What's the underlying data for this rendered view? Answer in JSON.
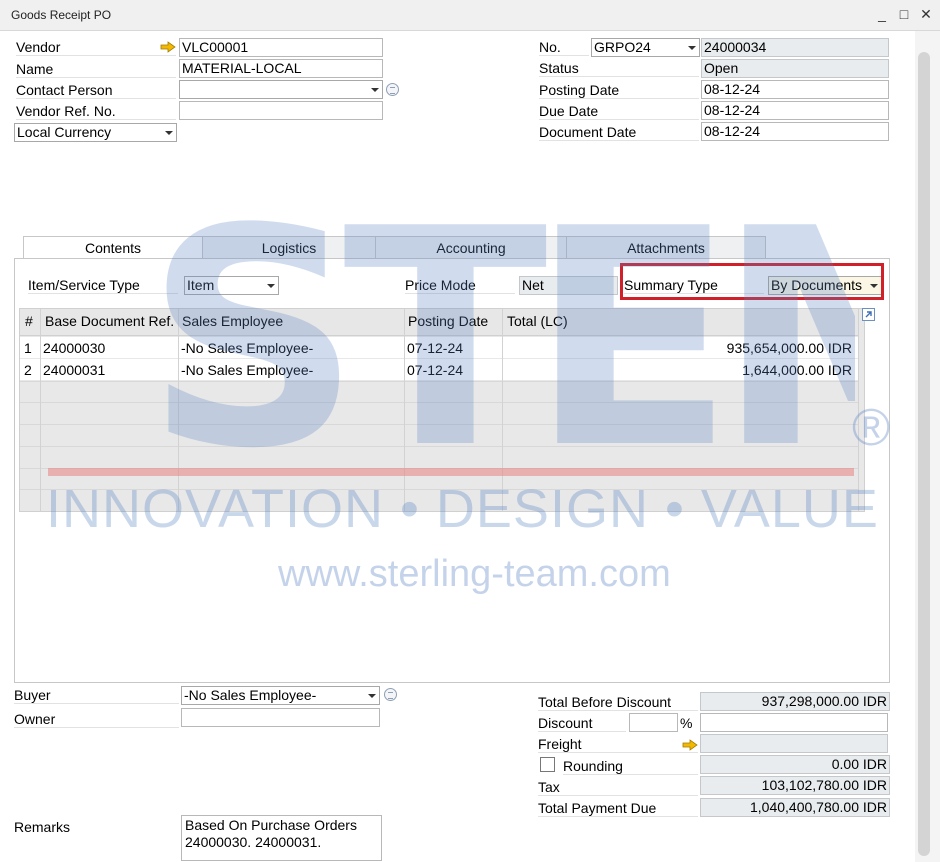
{
  "window": {
    "title": "Goods Receipt PO",
    "minimize": "_",
    "maximize": "□",
    "close": "✕"
  },
  "header_left": {
    "vendor_label": "Vendor",
    "vendor_value": "VLC00001",
    "name_label": "Name",
    "name_value": "MATERIAL-LOCAL",
    "contact_label": "Contact Person",
    "contact_value": "",
    "vendor_ref_label": "Vendor Ref. No.",
    "vendor_ref_value": "",
    "currency_value": "Local Currency"
  },
  "header_right": {
    "no_label": "No.",
    "series_value": "GRPO24",
    "no_value": "24000034",
    "status_label": "Status",
    "status_value": "Open",
    "posting_label": "Posting Date",
    "posting_value": "08-12-24",
    "due_label": "Due Date",
    "due_value": "08-12-24",
    "docdate_label": "Document Date",
    "docdate_value": "08-12-24"
  },
  "tabs": [
    {
      "label": "Contents"
    },
    {
      "label": "Logistics"
    },
    {
      "label": "Accounting"
    },
    {
      "label": "Attachments"
    }
  ],
  "contents": {
    "item_type_label": "Item/Service Type",
    "item_type_value": "Item",
    "price_mode_label": "Price Mode",
    "price_mode_value": "Net",
    "summary_type_label": "Summary Type",
    "summary_type_value": "By Documents"
  },
  "table": {
    "columns": [
      "#",
      "Base Document Ref.",
      "Sales Employee",
      "Posting Date",
      "Total (LC)"
    ],
    "rows": [
      {
        "num": "1",
        "base_ref": "24000030",
        "sales_emp": "-No Sales Employee-",
        "posting": "07-12-24",
        "total": "935,654,000.00 IDR"
      },
      {
        "num": "2",
        "base_ref": "24000031",
        "sales_emp": "-No Sales Employee-",
        "posting": "07-12-24",
        "total": "1,644,000.00 IDR"
      }
    ]
  },
  "footer_left": {
    "buyer_label": "Buyer",
    "buyer_value": "-No Sales Employee-",
    "owner_label": "Owner",
    "owner_value": "",
    "remarks_label": "Remarks",
    "remarks_line1": "Based On Purchase Orders",
    "remarks_line2": "24000030. 24000031."
  },
  "footer_right": {
    "total_before_label": "Total Before Discount",
    "total_before_value": "937,298,000.00 IDR",
    "discount_label": "Discount",
    "discount_pct": "",
    "pct_sign": "%",
    "discount_value": "",
    "freight_label": "Freight",
    "freight_value": "",
    "rounding_label": "Rounding",
    "rounding_value": "0.00 IDR",
    "tax_label": "Tax",
    "tax_value": "103,102,780.00 IDR",
    "total_due_label": "Total Payment Due",
    "total_due_value": "1,040,400,780.00 IDR"
  },
  "watermark": {
    "logo_text": "STEM",
    "registered": "®",
    "tagline": "INNOVATION • DESIGN • VALUE",
    "url": "www.sterling-team.com"
  },
  "colors": {
    "highlight": "#d0202a",
    "watermark": "#5a84c4",
    "arrow": "#f2b900"
  }
}
